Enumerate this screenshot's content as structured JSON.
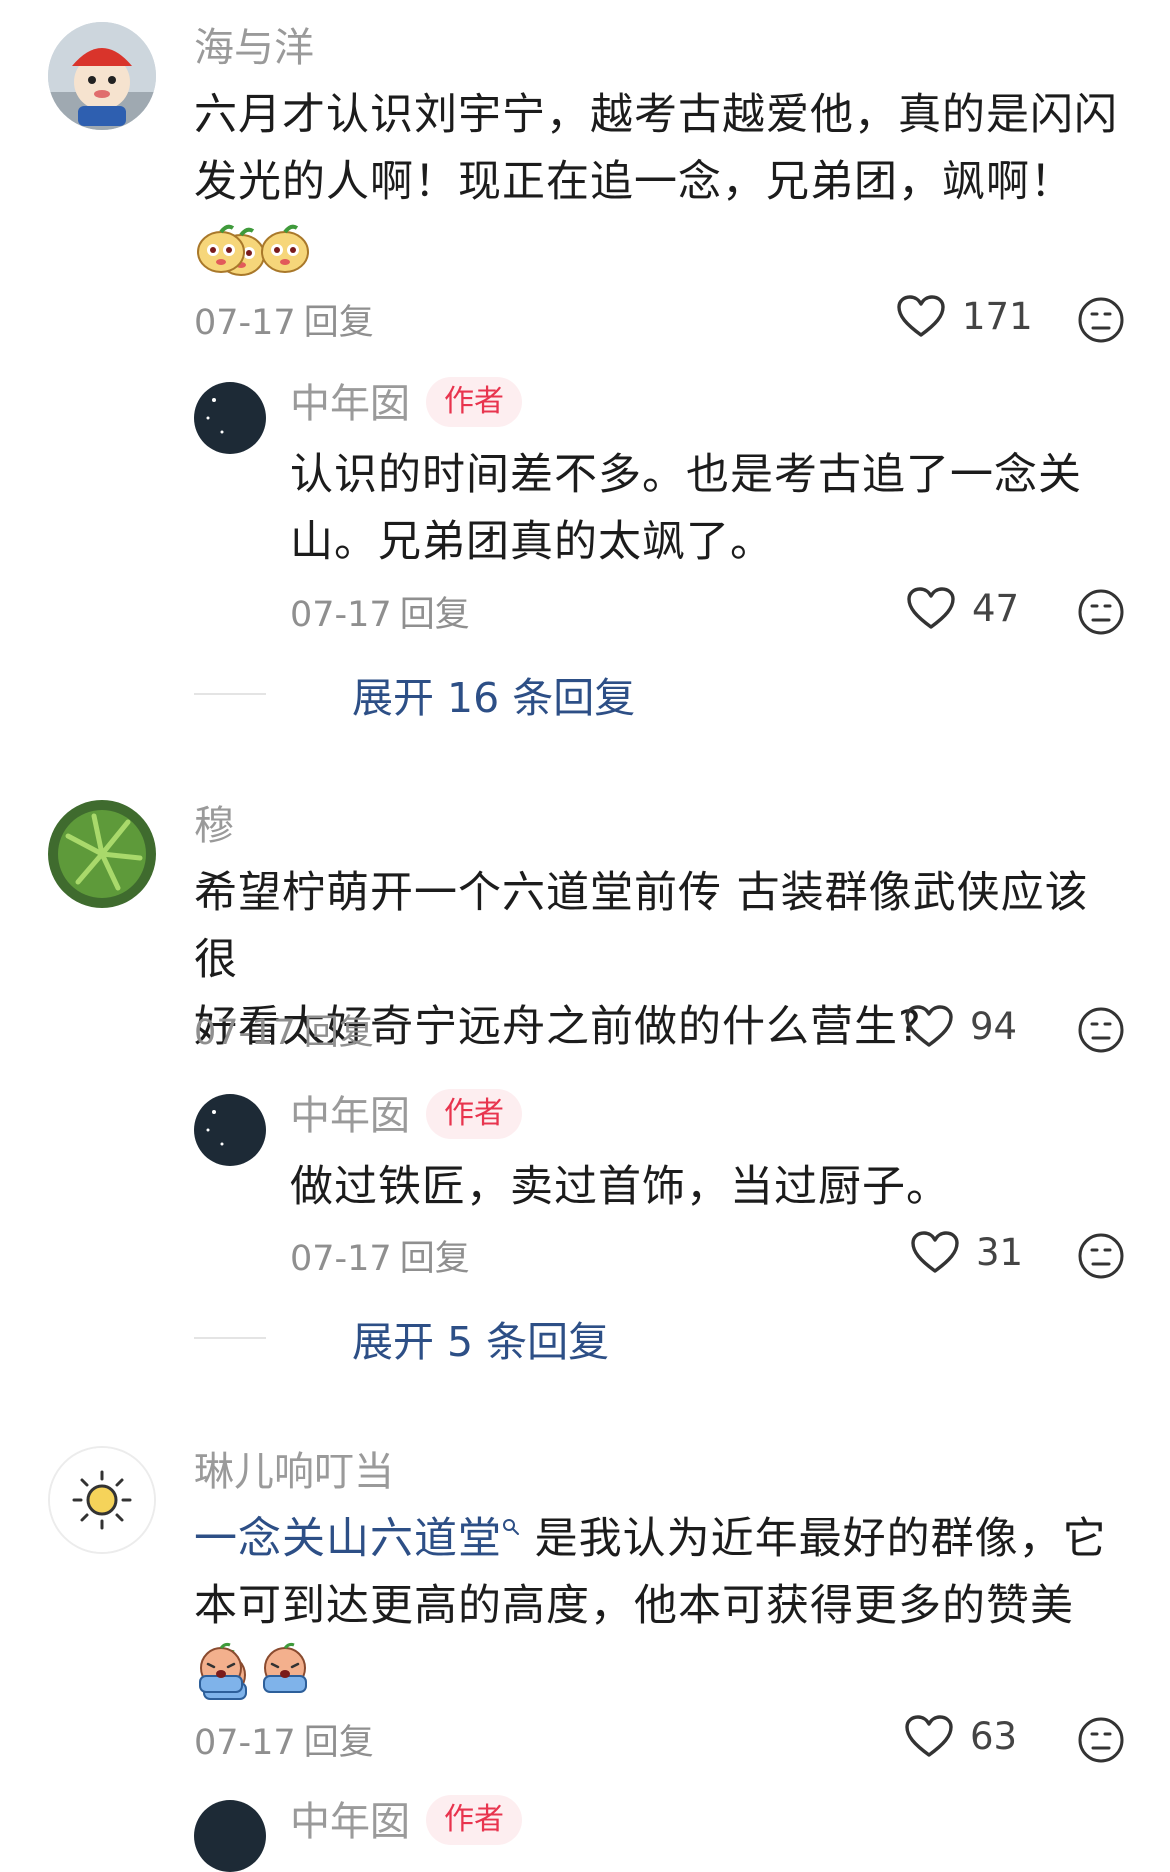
{
  "comments": [
    {
      "name": "海与洋",
      "text": "六月才认识刘宇宁，越考古越爱他，真的是闪闪发光的人啊！现正在追一念，兄弟团，飒啊！",
      "line1": "六月才认识刘宇宁，越考古越爱他，真的是闪闪",
      "line2": "发光的人啊！现正在追一念，兄弟团，飒啊！",
      "date": "07-17",
      "reply_label": "回复",
      "likes": "171",
      "replies": [
        {
          "name": "中年囡",
          "badge": "作者",
          "line1": "认识的时间差不多。也是考古追了一念关",
          "line2": "山。兄弟团真的太飒了。",
          "date": "07-17",
          "reply_label": "回复",
          "likes": "47"
        }
      ],
      "expand": "展开 16 条回复"
    },
    {
      "name": "穆",
      "line1": "希望柠萌开一个六道堂前传 古装群像武侠应该很",
      "line2": "好看太好奇宁远舟之前做的什么营生?",
      "date": "07-17",
      "reply_label": "回复",
      "likes": "94",
      "replies": [
        {
          "name": "中年囡",
          "badge": "作者",
          "line1": "做过铁匠，卖过首饰，当过厨子。",
          "date": "07-17",
          "reply_label": "回复",
          "likes": "31"
        }
      ],
      "expand": "展开 5 条回复"
    },
    {
      "name": "琳儿响叮当",
      "link": "一念关山六道堂",
      "line1_rest": " 是我认为近年最好的群像，它",
      "line2": "本可到达更高的高度，他本可获得更多的赞美",
      "date": "07-17",
      "reply_label": "回复",
      "likes": "63",
      "next_reply_name": "中年囡",
      "next_reply_badge": "作者"
    }
  ],
  "colors": {
    "accent_link": "#2d4f86",
    "author_badge": "#e8344e",
    "muted": "#8f8f8f"
  },
  "icons": [
    "heart-icon",
    "dislike-face-icon",
    "search-icon",
    "emoji-melon",
    "emoji-crying"
  ]
}
